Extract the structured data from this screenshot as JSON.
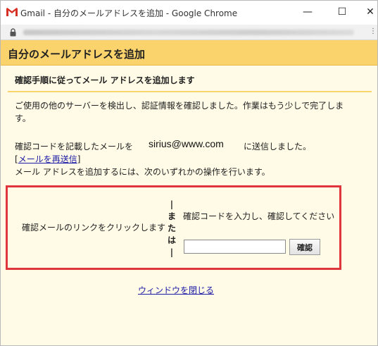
{
  "window": {
    "title": "Gmail - 自分のメールアドレスを追加 - Google Chrome",
    "minimize_glyph": "—",
    "maximize_glyph": "☐",
    "close_glyph": "✕"
  },
  "urlbar": {
    "menu_glyph": "⋮",
    "lock_icon": "lock-icon"
  },
  "header": {
    "title": "自分のメールアドレスを追加"
  },
  "subheader": {
    "text": "確認手順に従ってメール アドレスを追加します"
  },
  "body": {
    "detect_line1": "ご使用の他のサーバーを検出し、認証情報を確認しました。作業はもう少しで完了しま",
    "detect_line2": "す。",
    "sent_pre": "確認コードを記載したメールを",
    "email": "sirius@www.com",
    "sent_post": "に送信しました。",
    "resend_open": "[",
    "resend_link": "メールを再送信",
    "resend_close": "]",
    "instruction": "メール アドレスを追加するには、次のいずれかの操作を行います。"
  },
  "options": {
    "left_text": "確認メールのリンクをクリックします",
    "or_text": [
      "|",
      "ま",
      "た",
      "は",
      "|"
    ],
    "right_text": "確認コードを入力し、確認してください",
    "input_value": "",
    "confirm_label": "確認"
  },
  "footer": {
    "close_link": "ウィンドウを閉じる"
  },
  "colors": {
    "header_bg": "#fbd36d",
    "page_bg": "#fffbe6",
    "highlight_border": "#e0353a",
    "link": "#1a1aa6"
  }
}
